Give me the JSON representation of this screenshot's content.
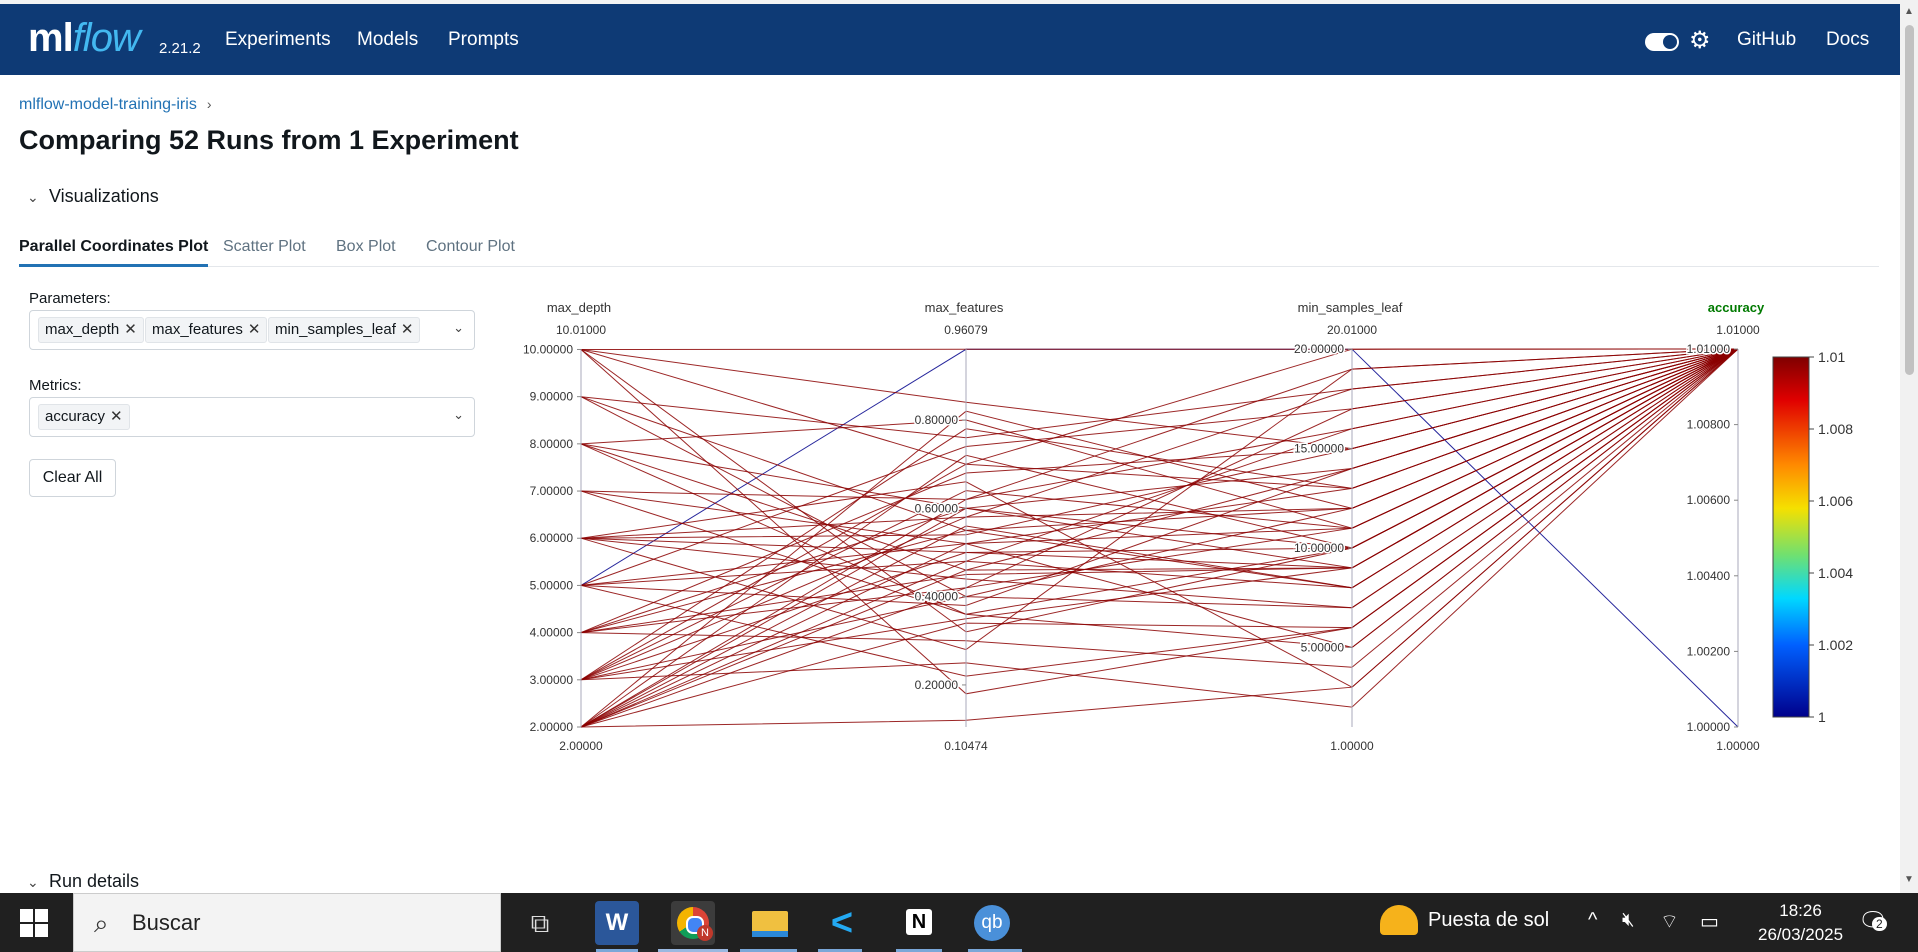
{
  "header": {
    "logo_ml": "ml",
    "logo_flow": "flow",
    "version": "2.21.2",
    "nav": [
      "Experiments",
      "Models",
      "Prompts"
    ],
    "github": "GitHub",
    "docs": "Docs"
  },
  "breadcrumb": {
    "experiment": "mlflow-model-training-iris",
    "separator": "›"
  },
  "page_title": "Comparing 52 Runs from 1 Experiment",
  "visualizations": {
    "section_title": "Visualizations",
    "tabs": [
      "Parallel Coordinates Plot",
      "Scatter Plot",
      "Box Plot",
      "Contour Plot"
    ],
    "active_tab": "Parallel Coordinates Plot"
  },
  "controls": {
    "parameters_label": "Parameters:",
    "parameters": [
      "max_depth",
      "max_features",
      "min_samples_leaf"
    ],
    "metrics_label": "Metrics:",
    "metrics": [
      "accuracy"
    ],
    "clear_all": "Clear All"
  },
  "chart_data": {
    "type": "parallel_coordinates",
    "axes": [
      {
        "name": "max_depth",
        "range": [
          2.0,
          10.01
        ],
        "top_label": "10.01000",
        "bottom_label": "2.00000",
        "ticks": [
          "10.00000",
          "9.00000",
          "8.00000",
          "7.00000",
          "6.00000",
          "5.00000",
          "4.00000",
          "3.00000",
          "2.00000"
        ],
        "tick_values": [
          10,
          9,
          8,
          7,
          6,
          5,
          4,
          3,
          2
        ]
      },
      {
        "name": "max_features",
        "range": [
          0.10474,
          0.96079
        ],
        "top_label": "0.96079",
        "bottom_label": "0.10474",
        "ticks": [
          "0.80000",
          "0.60000",
          "0.40000",
          "0.20000"
        ],
        "tick_values": [
          0.8,
          0.6,
          0.4,
          0.2
        ]
      },
      {
        "name": "min_samples_leaf",
        "range": [
          1.0,
          20.01
        ],
        "top_label": "20.01000",
        "bottom_label": "1.00000",
        "ticks": [
          "20.00000",
          "15.00000",
          "10.00000",
          "5.00000"
        ],
        "tick_values": [
          20,
          15,
          10,
          5
        ]
      },
      {
        "name": "accuracy",
        "range": [
          1.0,
          1.01
        ],
        "top_label": "1.01000",
        "bottom_label": "1.00000",
        "ticks": [
          "1.01000",
          "1.00800",
          "1.00600",
          "1.00400",
          "1.00200",
          "1.00000"
        ],
        "tick_values": [
          1.01,
          1.008,
          1.006,
          1.004,
          1.002,
          1.0
        ],
        "highlight": true
      }
    ],
    "colorscale": {
      "ticks": [
        "1.01",
        "1.008",
        "1.006",
        "1.004",
        "1.002",
        "1"
      ],
      "tick_values": [
        1.01,
        1.008,
        1.006,
        1.004,
        1.002,
        1.0
      ],
      "min": 1.0,
      "max": 1.01
    },
    "runs": [
      [
        5,
        0.96,
        20,
        1.0
      ],
      [
        10,
        0.96,
        20,
        1.01
      ],
      [
        10,
        0.84,
        15,
        1.01
      ],
      [
        10,
        0.7,
        13,
        1.01
      ],
      [
        10,
        0.32,
        10,
        1.01
      ],
      [
        10,
        0.18,
        6,
        1.01
      ],
      [
        9,
        0.76,
        18,
        1.01
      ],
      [
        9,
        0.55,
        8,
        1.01
      ],
      [
        9,
        0.4,
        12,
        1.01
      ],
      [
        8,
        0.8,
        11,
        1.01
      ],
      [
        8,
        0.6,
        9,
        1.01
      ],
      [
        8,
        0.46,
        14,
        1.01
      ],
      [
        7,
        0.62,
        16,
        1.01
      ],
      [
        7,
        0.52,
        5,
        1.01
      ],
      [
        7,
        0.36,
        10,
        1.01
      ],
      [
        6,
        0.58,
        12,
        1.01
      ],
      [
        6,
        0.5,
        9,
        1.01
      ],
      [
        6,
        0.44,
        7,
        1.01
      ],
      [
        6,
        0.28,
        19,
        1.01
      ],
      [
        6,
        0.66,
        3,
        1.01
      ],
      [
        5,
        0.52,
        11,
        1.01
      ],
      [
        5,
        0.48,
        8,
        1.01
      ],
      [
        5,
        0.38,
        14,
        1.01
      ],
      [
        5,
        0.22,
        6,
        1.01
      ],
      [
        5,
        0.74,
        17,
        1.01
      ],
      [
        4,
        0.6,
        10,
        1.01
      ],
      [
        4,
        0.55,
        12,
        1.01
      ],
      [
        4,
        0.45,
        9,
        1.01
      ],
      [
        4,
        0.3,
        4,
        1.01
      ],
      [
        4,
        0.68,
        15,
        1.01
      ],
      [
        3,
        0.78,
        13,
        1.01
      ],
      [
        3,
        0.64,
        11,
        1.01
      ],
      [
        3,
        0.5,
        10,
        1.01
      ],
      [
        3,
        0.4,
        7,
        1.01
      ],
      [
        3,
        0.25,
        2,
        1.01
      ],
      [
        3,
        0.58,
        18,
        1.01
      ],
      [
        3,
        0.35,
        9,
        1.01
      ],
      [
        2,
        0.82,
        12,
        1.01
      ],
      [
        2,
        0.72,
        10,
        1.01
      ],
      [
        2,
        0.6,
        14,
        1.01
      ],
      [
        2,
        0.56,
        8,
        1.01
      ],
      [
        2,
        0.48,
        16,
        1.01
      ],
      [
        2,
        0.42,
        11,
        1.01
      ],
      [
        2,
        0.34,
        6,
        1.01
      ],
      [
        2,
        0.12,
        3,
        1.01
      ],
      [
        2,
        0.62,
        19,
        1.01
      ],
      [
        2,
        0.52,
        13,
        1.01
      ],
      [
        2,
        0.46,
        9,
        1.01
      ],
      [
        6,
        0.54,
        15,
        1.01
      ],
      [
        4,
        0.42,
        17,
        1.01
      ],
      [
        8,
        0.36,
        5,
        1.01
      ],
      [
        3,
        0.7,
        20,
        1.01
      ]
    ]
  },
  "run_details_title": "Run details",
  "taskbar": {
    "search_text": "Buscar",
    "weather": "Puesta de sol",
    "time": "18:26",
    "date": "26/03/2025",
    "notifications": "2",
    "apps": [
      "task-view",
      "word",
      "chrome",
      "file-explorer",
      "vscode",
      "notion",
      "qbittorrent"
    ]
  },
  "colors": {
    "header_bg": "#0e3a75",
    "link": "#2272b4",
    "line": "#8b0000",
    "highlight_line": "#00008b",
    "accuracy_label": "#007a00"
  }
}
